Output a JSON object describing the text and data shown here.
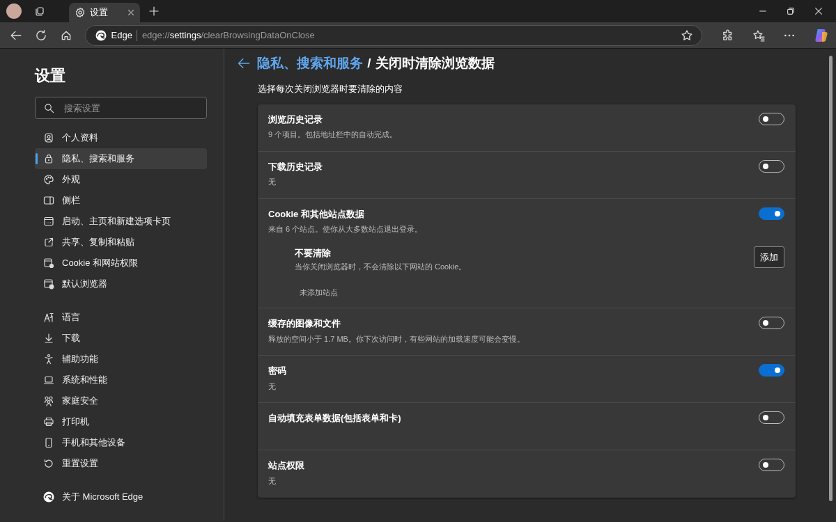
{
  "browser": {
    "tab": {
      "title": "设置"
    },
    "address": {
      "site_label": "Edge",
      "url_scheme": "edge://",
      "url_host": "settings",
      "url_path": "/clearBrowsingDataOnClose"
    }
  },
  "sidebar": {
    "title": "设置",
    "search": {
      "placeholder": "搜索设置"
    },
    "groups": [
      [
        {
          "label": "个人资料",
          "selected": false
        },
        {
          "label": "隐私、搜索和服务",
          "selected": true
        },
        {
          "label": "外观",
          "selected": false
        },
        {
          "label": "侧栏",
          "selected": false
        },
        {
          "label": "启动、主页和新建选项卡页",
          "selected": false
        },
        {
          "label": "共享、复制和粘贴",
          "selected": false
        },
        {
          "label": "Cookie 和网站权限",
          "selected": false
        },
        {
          "label": "默认浏览器",
          "selected": false
        }
      ],
      [
        {
          "label": "语言",
          "selected": false
        },
        {
          "label": "下载",
          "selected": false
        },
        {
          "label": "辅助功能",
          "selected": false
        },
        {
          "label": "系统和性能",
          "selected": false
        },
        {
          "label": "家庭安全",
          "selected": false
        },
        {
          "label": "打印机",
          "selected": false
        },
        {
          "label": "手机和其他设备",
          "selected": false
        },
        {
          "label": "重置设置",
          "selected": false
        }
      ],
      [
        {
          "label": "关于 Microsoft Edge",
          "selected": false
        }
      ]
    ]
  },
  "page": {
    "breadcrumb_link": "隐私、搜索和服务",
    "breadcrumb_separator": "/",
    "title": "关闭时清除浏览数据",
    "subtitle": "选择每次关闭浏览器时要清除的内容",
    "settings": [
      {
        "title": "浏览历史记录",
        "description": "9 个项目。包括地址栏中的自动完成。",
        "on": false
      },
      {
        "title": "下载历史记录",
        "description": "无",
        "on": false
      },
      {
        "title": "Cookie 和其他站点数据",
        "description": "来自 6 个站点。使你从大多数站点退出登录。",
        "on": true,
        "exceptions": {
          "title": "不要清除",
          "description": "当你关闭浏览器时，不会清除以下网站的 Cookie。",
          "empty": "未添加站点",
          "button": "添加"
        }
      },
      {
        "title": "缓存的图像和文件",
        "description": "释放的空间小于 1.7 MB。你下次访问时，有些网站的加载速度可能会变慢。",
        "on": false
      },
      {
        "title": "密码",
        "description": "无",
        "on": true
      },
      {
        "title": "自动填充表单数据(包括表单和卡)",
        "on": false
      },
      {
        "title": "站点权限",
        "description": "无",
        "on": false
      }
    ]
  }
}
